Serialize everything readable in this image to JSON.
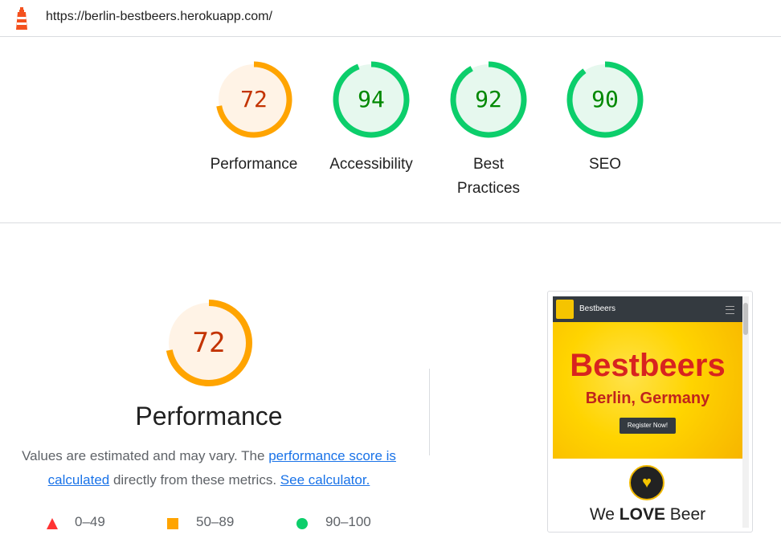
{
  "header": {
    "url": "https://berlin-bestbeers.herokuapp.com/",
    "logo_icon": "lighthouse-icon"
  },
  "scores": [
    {
      "value": "72",
      "label": "Performance",
      "fraction": 0.72,
      "ring_color": "#ffa400",
      "bg_color": "#fff3e6",
      "text_color": "#c33300"
    },
    {
      "value": "94",
      "label": "Accessibility",
      "fraction": 0.94,
      "ring_color": "#0cce6b",
      "bg_color": "#e6f8ee",
      "text_color": "#008800"
    },
    {
      "value": "92",
      "label": "Best Practices",
      "fraction": 0.92,
      "ring_color": "#0cce6b",
      "bg_color": "#e6f8ee",
      "text_color": "#008800"
    },
    {
      "value": "90",
      "label": "SEO",
      "fraction": 0.9,
      "ring_color": "#0cce6b",
      "bg_color": "#e6f8ee",
      "text_color": "#008800"
    }
  ],
  "performance": {
    "score": "72",
    "fraction": 0.72,
    "title": "Performance",
    "desc_prefix": "Values are estimated and may vary. The ",
    "link_score": "performance score is calculated",
    "desc_middle": " directly from these metrics. ",
    "link_calculator": "See calculator."
  },
  "legend": [
    {
      "range": "0–49",
      "shape": "triangle",
      "color": "#ff3333"
    },
    {
      "range": "50–89",
      "shape": "square",
      "color": "#ffa400"
    },
    {
      "range": "90–100",
      "shape": "circle",
      "color": "#0cce6b"
    }
  ],
  "screenshot": {
    "brand": "Bestbeers",
    "hero_title": "Bestbeers",
    "hero_subtitle": "Berlin, Germany",
    "cta": "Register Now!",
    "tagline_pre": "We ",
    "tagline_bold": "LOVE",
    "tagline_post": " Beer",
    "heart_icon": "heart-icon"
  }
}
